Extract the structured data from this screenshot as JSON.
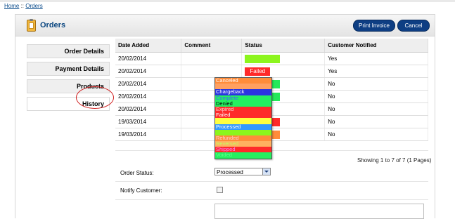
{
  "breadcrumb": {
    "home": "Home",
    "separator": "::",
    "orders": "Orders"
  },
  "header": {
    "title": "Orders",
    "print_label": "Print Invoice",
    "cancel_label": "Cancel"
  },
  "tabs": [
    "Order Details",
    "Payment Details",
    "Products",
    "History"
  ],
  "table": {
    "headers": [
      "Date Added",
      "Comment",
      "Status",
      "Customer Notified"
    ],
    "rows": [
      {
        "date": "20/02/2014",
        "comment": "",
        "status": "",
        "status_color": "#8cf51d",
        "notified": "Yes"
      },
      {
        "date": "20/02/2014",
        "comment": "",
        "status": "Failed",
        "status_color": "#ff2a2a",
        "notified": "Yes"
      },
      {
        "date": "20/02/2014",
        "comment": "",
        "status": "",
        "status_color": "#24e85a",
        "notified": "No"
      },
      {
        "date": "20/02/2014",
        "comment": "",
        "status": "",
        "status_color": "#24e85a",
        "notified": "No"
      },
      {
        "date": "20/02/2014",
        "comment": "",
        "status": "",
        "status_color": "#ffffff",
        "notified": "No"
      },
      {
        "date": "19/03/2014",
        "comment": "",
        "status": "",
        "status_color": "#ff2a2a",
        "notified": "No"
      },
      {
        "date": "19/03/2014",
        "comment": "",
        "status": "",
        "status_color": "#ff8c3a",
        "notified": "No"
      }
    ]
  },
  "paging": "Showing 1 to 7 of 7 (1 Pages)",
  "form": {
    "order_status_label": "Order Status:",
    "order_status_value": "Processed",
    "notify_label": "Notify Customer:"
  },
  "status_options": [
    {
      "label": "Canceled",
      "bg": "#ff8c3a",
      "fg": "#ffffff"
    },
    {
      "label": "",
      "bg": "#ffa060",
      "fg": "#ffffff"
    },
    {
      "label": "Chargeback",
      "bg": "#2b35e0",
      "fg": "#ffffff"
    },
    {
      "label": "Complete",
      "bg": "#24f060",
      "fg": "#4060ff"
    },
    {
      "label": "Denied",
      "bg": "#24f060",
      "fg": "#000000"
    },
    {
      "label": "Expired",
      "bg": "#ff2a2a",
      "fg": "#ffd0d0"
    },
    {
      "label": "Failed",
      "bg": "#ff2a2a",
      "fg": "#ffffff"
    },
    {
      "label": "",
      "bg": "#ffff40",
      "fg": "#000000"
    },
    {
      "label": "Processed",
      "bg": "#3399ff",
      "fg": "#ffffff"
    },
    {
      "label": "",
      "bg": "#8cf51d",
      "fg": "#000000"
    },
    {
      "label": "Refunded",
      "bg": "#ff8c3a",
      "fg": "#ffd0d0"
    },
    {
      "label": "Reversed",
      "bg": "#ffb060",
      "fg": "#c0ff60"
    },
    {
      "label": "Shipped",
      "bg": "#ff2a2a",
      "fg": "#ff80ff"
    },
    {
      "label": "Voided",
      "bg": "#24f060",
      "fg": "#60ff90"
    }
  ]
}
